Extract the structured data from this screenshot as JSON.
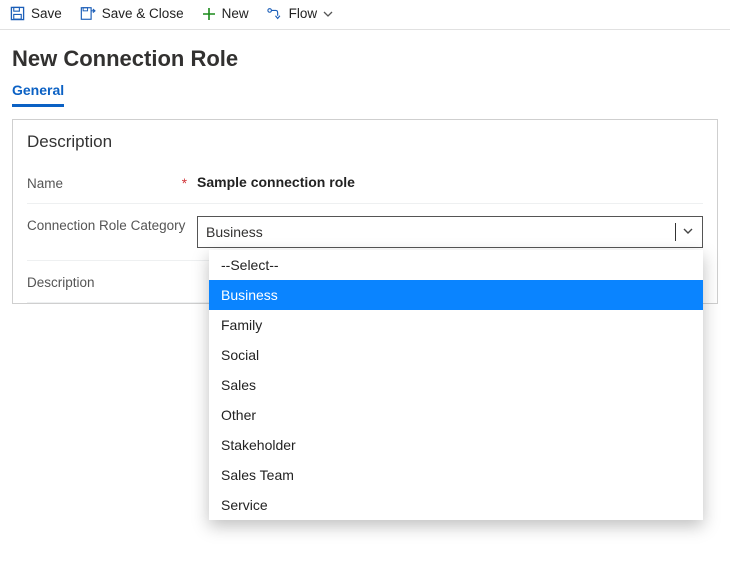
{
  "toolbar": {
    "save": "Save",
    "saveClose": "Save & Close",
    "new": "New",
    "flow": "Flow"
  },
  "pageTitle": "New Connection Role",
  "tabs": {
    "general": "General"
  },
  "section": {
    "title": "Description",
    "name": {
      "label": "Name",
      "value": "Sample connection role"
    },
    "category": {
      "label": "Connection Role Category",
      "value": "Business"
    },
    "description": {
      "label": "Description"
    }
  },
  "dropdown": {
    "options": [
      "--Select--",
      "Business",
      "Family",
      "Social",
      "Sales",
      "Other",
      "Stakeholder",
      "Sales Team",
      "Service"
    ],
    "selected": "Business"
  }
}
